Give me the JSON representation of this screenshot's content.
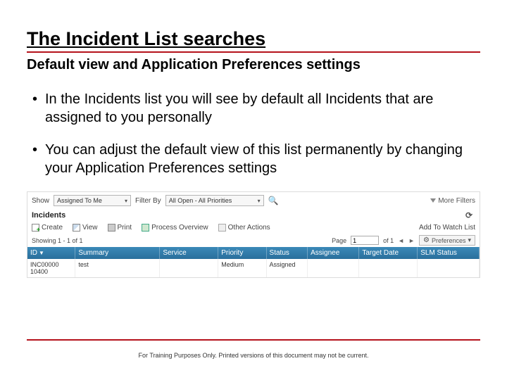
{
  "title": "The Incident List searches",
  "subtitle": "Default view and Application Preferences settings",
  "bullets": [
    "In the Incidents list you will see by default all Incidents that are assigned to you personally",
    "You can adjust the default view of this list permanently by changing your Application Preferences settings"
  ],
  "filterbar": {
    "show_label": "Show",
    "show_value": "Assigned To Me",
    "filterby_label": "Filter By",
    "filterby_value": "All Open - All Priorities",
    "more_filters": "More Filters"
  },
  "section_label": "Incidents",
  "toolbar": {
    "create": "Create",
    "view": "View",
    "print": "Print",
    "process": "Process Overview",
    "other": "Other Actions",
    "watchlist": "Add To Watch List"
  },
  "pager": {
    "showing": "Showing 1 - 1 of 1",
    "page_label": "Page",
    "page_value": "1",
    "of_label": "of 1",
    "preferences": "Preferences"
  },
  "columns": {
    "id": "ID",
    "summary": "Summary",
    "service": "Service",
    "priority": "Priority",
    "status": "Status",
    "assignee": "Assignee",
    "target": "Target Date",
    "slm": "SLM Status"
  },
  "row": {
    "id": "INC00000 10400",
    "summary": "test",
    "service": "",
    "priority": "Medium",
    "status": "Assigned",
    "assignee": "",
    "target": "",
    "slm": ""
  },
  "footer": "For Training Purposes Only. Printed versions of this document may not be current."
}
